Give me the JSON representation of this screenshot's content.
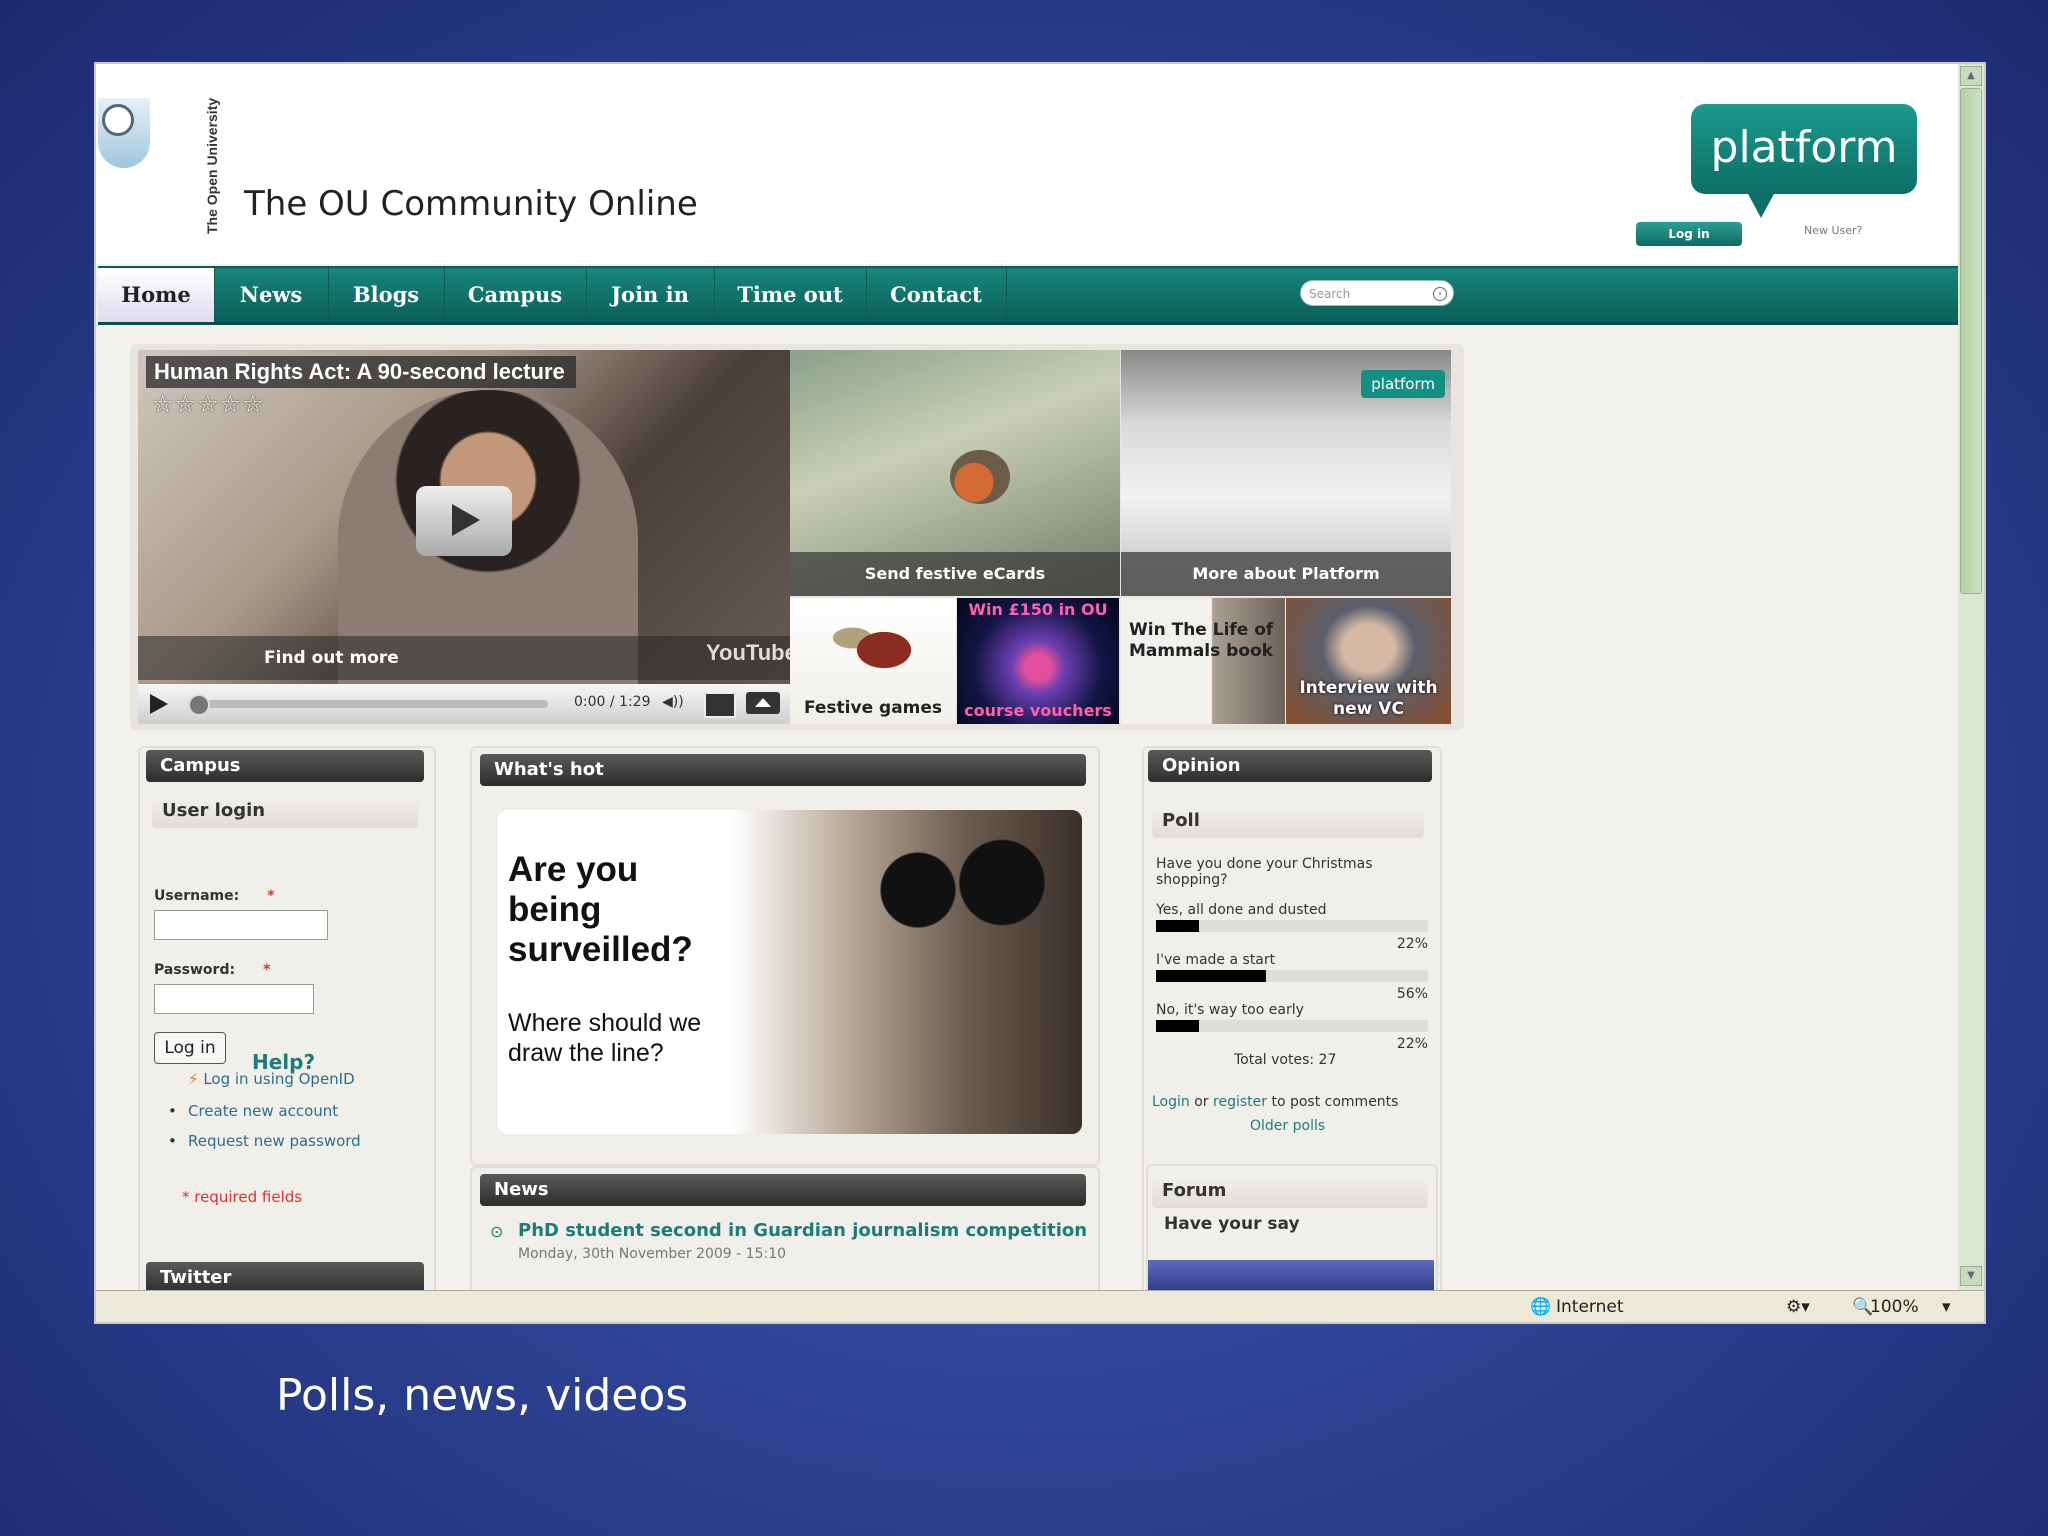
{
  "header": {
    "university_vertical": "The Open University",
    "site_title": "The OU Community Online",
    "platform_logo": "platform",
    "login_button": "Log in",
    "new_user": "New User?"
  },
  "nav": {
    "items": [
      "Home",
      "News",
      "Blogs",
      "Campus",
      "Join in",
      "Time out",
      "Contact"
    ],
    "search_placeholder": "Search"
  },
  "featured": {
    "video_title": "Human Rights Act: A  90-second lecture",
    "stars": "☆☆☆☆☆",
    "find_out_more": "Find out more",
    "youtube": "YouTube",
    "time": "0:00 / 1:29",
    "tiles": {
      "ecards": "Send festive eCards",
      "platform": "More about Platform",
      "platform_badge": "platform",
      "festive": "Festive games",
      "win_top": "Win £150 in OU",
      "win_bottom": "course vouchers",
      "mammals": "Win The Life of Mammals book",
      "vc": "Interview with new VC"
    }
  },
  "campus": {
    "title": "Campus",
    "user_login": "User login",
    "username_label": "Username:",
    "password_label": "Password:",
    "required_mark": "*",
    "login_button": "Log in",
    "help": "Help?",
    "openid": "Log in using OpenID",
    "create_account": "Create new account",
    "request_password": "Request new password",
    "required_fields": "* required fields",
    "twitter": "Twitter"
  },
  "whats_hot": {
    "title": "What's hot",
    "headline": "Are you being surveilled?",
    "subline": "Where should we draw the line?"
  },
  "news": {
    "title": "News",
    "item_title": "PhD student second in Guardian journalism competition",
    "item_date": "Monday, 30th November 2009 - 15:10"
  },
  "opinion": {
    "title": "Opinion",
    "poll_title": "Poll",
    "question": "Have you done your Christmas shopping?",
    "options": [
      {
        "label": "Yes, all done and dusted",
        "percent": 22
      },
      {
        "label": "I've made a start",
        "percent": 56
      },
      {
        "label": "No, it's way too early",
        "percent": 22
      }
    ],
    "percent_labels": [
      "22%",
      "56%",
      "22%"
    ],
    "total_votes": "Total votes: 27",
    "login": "Login",
    "or": "or",
    "register": "register",
    "post_comments": "to post comments",
    "older_polls": "Older polls",
    "forum_title": "Forum",
    "forum_sub": "Have your say"
  },
  "status_bar": {
    "zone": "Internet",
    "zoom": "100%"
  },
  "slide_caption": "Polls, news, videos"
}
